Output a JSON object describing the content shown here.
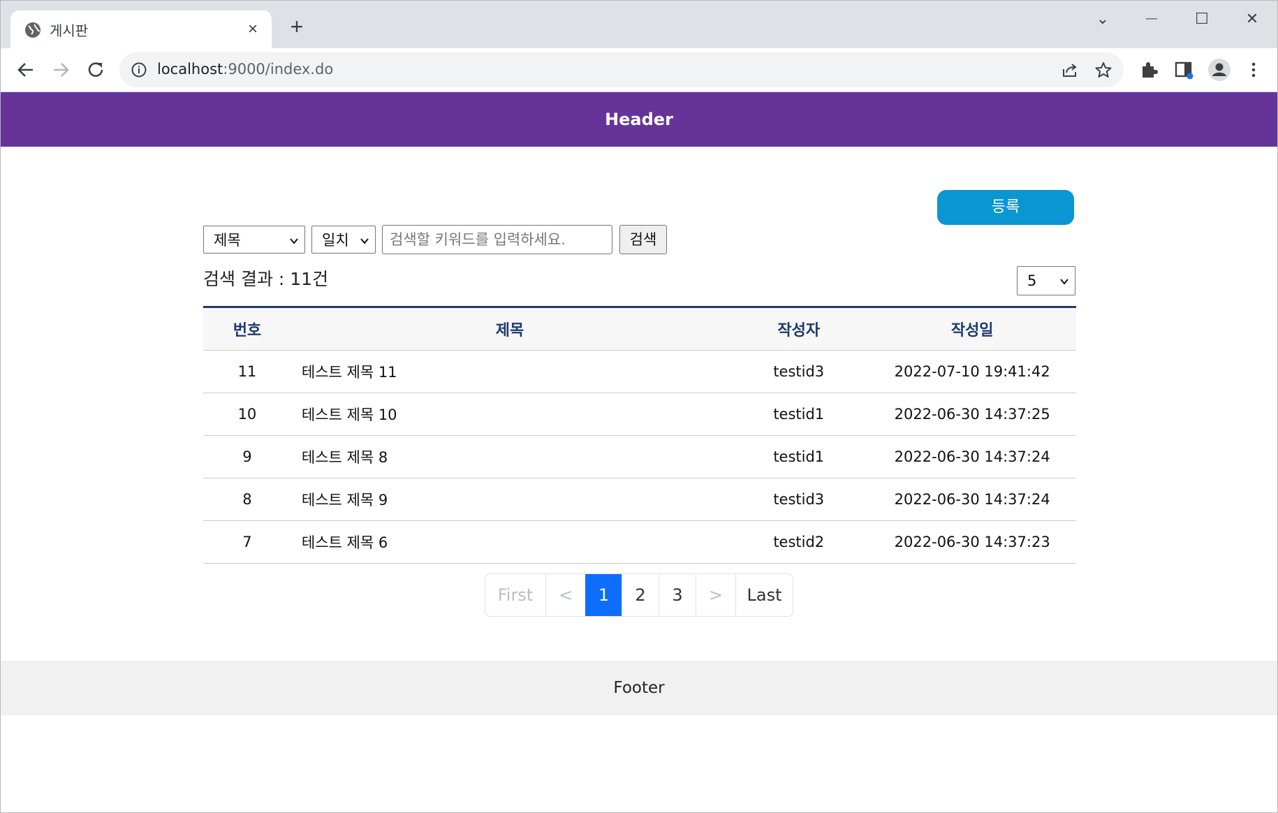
{
  "browser": {
    "tab": {
      "title": "게시판",
      "close_icon": "×"
    },
    "new_tab_icon": "+",
    "window_controls": {
      "dropdown": "⌄",
      "minimize": "—",
      "maximize": "☐",
      "close": "✕"
    },
    "address": {
      "host": "localhost",
      "path": ":9000/index.do"
    }
  },
  "page": {
    "header_title": "Header",
    "register_button": "등록",
    "search": {
      "field_select": {
        "selected": "제목"
      },
      "match_select": {
        "selected": "일치"
      },
      "keyword_placeholder": "검색할 키워드를 입력하세요.",
      "search_button": "검색"
    },
    "result_count": "검색 결과 : 11건",
    "page_size_select": {
      "selected": "5"
    },
    "table": {
      "columns": [
        "번호",
        "제목",
        "작성자",
        "작성일"
      ],
      "rows": [
        {
          "num": "11",
          "title": "테스트 제목 11",
          "writer": "testid3",
          "date": "2022-07-10 19:41:42"
        },
        {
          "num": "10",
          "title": "테스트 제목 10",
          "writer": "testid1",
          "date": "2022-06-30 14:37:25"
        },
        {
          "num": "9",
          "title": "테스트 제목 8",
          "writer": "testid1",
          "date": "2022-06-30 14:37:24"
        },
        {
          "num": "8",
          "title": "테스트 제목 9",
          "writer": "testid3",
          "date": "2022-06-30 14:37:24"
        },
        {
          "num": "7",
          "title": "테스트 제목 6",
          "writer": "testid2",
          "date": "2022-06-30 14:37:23"
        }
      ]
    },
    "pagination": {
      "first": "First",
      "prev": "<",
      "pages": [
        "1",
        "2",
        "3"
      ],
      "next": ">",
      "last": "Last",
      "current": "1"
    },
    "footer_text": "Footer"
  },
  "colors": {
    "header_bg": "#663399",
    "register_bg": "#0a96d2",
    "pagination_active": "#0d6efd",
    "table_header_text": "#1e3a6e",
    "footer_bg": "#f1f1f1"
  }
}
